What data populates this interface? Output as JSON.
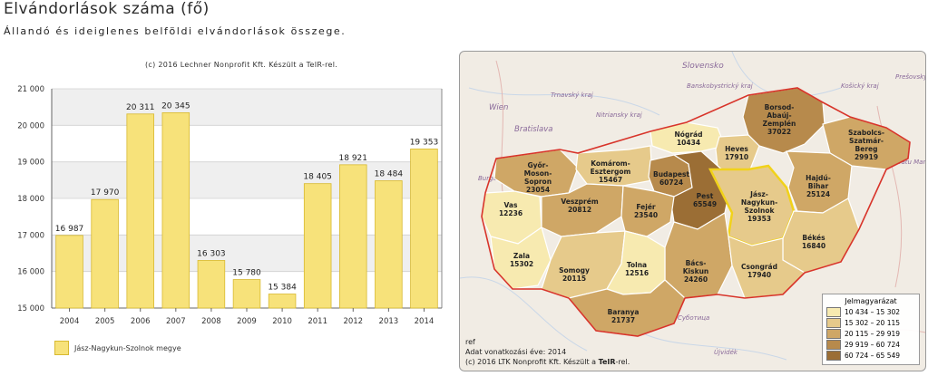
{
  "header": {
    "title": "Elvándorlások száma (fő)",
    "subtitle": "Állandó és ideiglenes belföldi elvándorlások összege.",
    "credit": "(c) 2016 Lechner Nonprofit Kft. Készült a TeIR-rel."
  },
  "chart_data": {
    "type": "bar",
    "categories": [
      "2004",
      "2005",
      "2006",
      "2007",
      "2008",
      "2009",
      "2010",
      "2011",
      "2012",
      "2013",
      "2014"
    ],
    "series": [
      {
        "name": "Jász-Nagykun-Szolnok megye",
        "values": [
          16987,
          17970,
          20311,
          20345,
          16303,
          15780,
          15384,
          18405,
          18921,
          18484,
          19353
        ],
        "labels": [
          "16 987",
          "17 970",
          "20 311",
          "20 345",
          "16 303",
          "15 780",
          "15 384",
          "18 405",
          "18 921",
          "18 484",
          "19 353"
        ]
      }
    ],
    "ylim": [
      15000,
      21000
    ],
    "yticks": [
      15000,
      16000,
      17000,
      18000,
      19000,
      20000,
      21000
    ],
    "ytick_labels": [
      "15 000",
      "16 000",
      "17 000",
      "18 000",
      "19 000",
      "20 000",
      "21 000"
    ],
    "grid": true,
    "legend_placement": "bottom-left",
    "colors": {
      "bar_fill": "#f7e27a",
      "bar_stroke": "#d8b930",
      "band": "#efefef"
    }
  },
  "map": {
    "counties": [
      {
        "name": "Borsod-Abaúj-Zemplén",
        "value": "37022",
        "cls": 4
      },
      {
        "name": "Szabolcs-Szatmár-Bereg",
        "value": "29919",
        "cls": 3
      },
      {
        "name": "Nógrád",
        "value": "10434",
        "cls": 1
      },
      {
        "name": "Heves",
        "value": "17910",
        "cls": 2
      },
      {
        "name": "Hajdú-Bihar",
        "value": "25124",
        "cls": 3
      },
      {
        "name": "Győr-Moson-Sopron",
        "value": "23054",
        "cls": 3
      },
      {
        "name": "Komárom-Esztergom",
        "value": "15467",
        "cls": 2
      },
      {
        "name": "Budapest",
        "value": "60724",
        "cls": 4
      },
      {
        "name": "Pest",
        "value": "65549",
        "cls": 5
      },
      {
        "name": "Jász-Nagykun-Szolnok",
        "value": "19353",
        "cls": 2
      },
      {
        "name": "Vas",
        "value": "12236",
        "cls": 1
      },
      {
        "name": "Veszprém",
        "value": "20812",
        "cls": 3
      },
      {
        "name": "Fejér",
        "value": "23540",
        "cls": 3
      },
      {
        "name": "Békés",
        "value": "16840",
        "cls": 2
      },
      {
        "name": "Zala",
        "value": "15302",
        "cls": 1
      },
      {
        "name": "Bács-Kiskun",
        "value": "24260",
        "cls": 3
      },
      {
        "name": "Csongrád",
        "value": "17940",
        "cls": 2
      },
      {
        "name": "Somogy",
        "value": "20115",
        "cls": 2
      },
      {
        "name": "Tolna",
        "value": "12516",
        "cls": 1
      },
      {
        "name": "Baranya",
        "value": "21737",
        "cls": 3
      }
    ],
    "places": [
      "Slovensko",
      "Wien",
      "Bratislava",
      "Banskobystrický kraj",
      "Košický kraj",
      "Nitriansky kraj",
      "Trnavský kraj",
      "Prešovský kraj",
      "Satu Mare",
      "Burgenland",
      "Újvidék",
      "Суботица"
    ],
    "legend": {
      "title": "Jelmagyarázat",
      "classes": [
        {
          "label": "10 434 – 15 302",
          "color": "#f7eab0"
        },
        {
          "label": "15 302 – 20 115",
          "color": "#e6ca8b"
        },
        {
          "label": "20 115 – 29 919",
          "color": "#cfa766"
        },
        {
          "label": "29 919 – 60 724",
          "color": "#b78a4c"
        },
        {
          "label": "60 724 – 65 549",
          "color": "#9b6e35"
        }
      ]
    },
    "footer": {
      "ref": "ref",
      "year_label": "Adat vonatkozási éve: 2014",
      "credit_prefix": "(c) 2016 LTK Nonprofit Kft. Készült a ",
      "credit_brand": "TeIR",
      "credit_suffix": "-rel."
    }
  }
}
